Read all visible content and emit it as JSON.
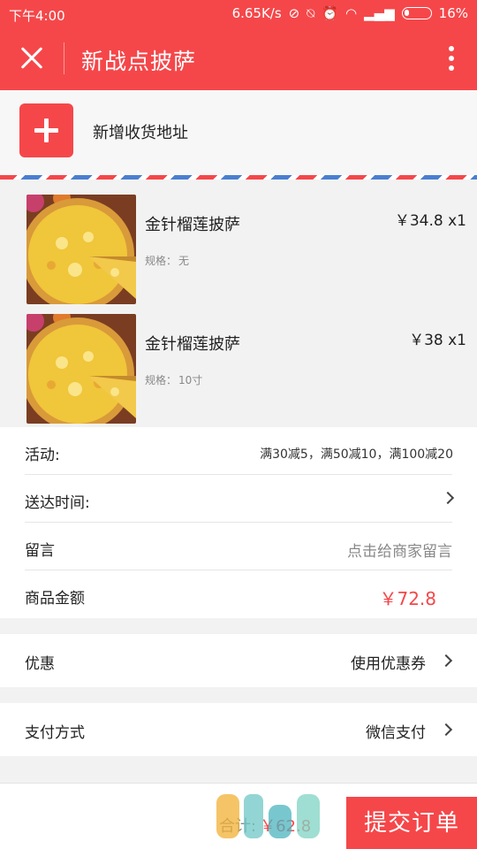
{
  "status_bar": {
    "time": "下午4:00",
    "network_speed": "6.65K/s",
    "battery": "16%"
  },
  "header": {
    "title": "新战点披萨"
  },
  "address": {
    "add_label": "新增收货地址"
  },
  "items": [
    {
      "name": "金针榴莲披萨",
      "spec_label": "规格：",
      "spec_value": "无",
      "price": "￥34.8 x1"
    },
    {
      "name": "金针榴莲披萨",
      "spec_label": "规格：",
      "spec_value": "10寸",
      "price": "￥38 x1"
    }
  ],
  "info": {
    "activity_label": "活动:",
    "activity_value": "满30减5，满50减10，满100减20",
    "delivery_label": "送达时间:",
    "message_label": "留言",
    "message_hint": "点击给商家留言",
    "subtotal_label": "商品金额",
    "subtotal_value": "￥72.8"
  },
  "discount": {
    "label": "优惠",
    "value": "使用优惠券"
  },
  "payment": {
    "label": "支付方式",
    "value": "微信支付"
  },
  "bottom": {
    "total_label": "合计:",
    "total_value": "￥62.8",
    "submit_label": "提交订单"
  },
  "colors": {
    "accent": "#f5474a",
    "airmail_blue": "#4a7fd0"
  }
}
